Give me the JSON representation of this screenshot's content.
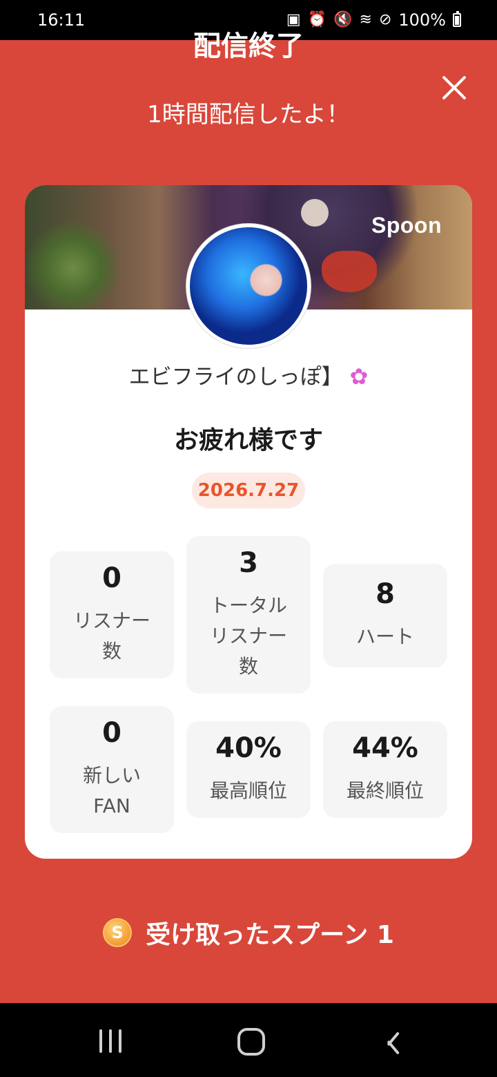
{
  "status_bar": {
    "time": "16:11",
    "battery_percent": "100%",
    "icons": [
      "sim-icon",
      "alarm-icon",
      "mute-icon",
      "wifi-icon",
      "do-not-disturb-icon",
      "battery-icon"
    ]
  },
  "header": {
    "title": "配信終了",
    "subtitle": "1時間配信したよ！"
  },
  "card": {
    "brand_logo": "Spoon",
    "username": "エビフライのしっぽ】",
    "username_emoji": "✿",
    "greeting": "お疲れ様です",
    "date": "2026.7.27",
    "stats": [
      {
        "value": "0",
        "label_lines": [
          "リスナー",
          "数"
        ]
      },
      {
        "value": "3",
        "label_lines": [
          "トータル",
          "リスナー",
          "数"
        ]
      },
      {
        "value": "8",
        "label_lines": [
          "ハート"
        ]
      },
      {
        "value": "0",
        "label_lines": [
          "新しい",
          "FAN"
        ]
      },
      {
        "value": "40%",
        "label_lines": [
          "最高順位"
        ]
      },
      {
        "value": "44%",
        "label_lines": [
          "最終順位"
        ]
      }
    ]
  },
  "spoons": {
    "coin_letter": "S",
    "label": "受け取ったスプーン 1"
  },
  "colors": {
    "background": "#d9473a",
    "date_text": "#e8552a",
    "date_pill": "#fde8e2"
  }
}
